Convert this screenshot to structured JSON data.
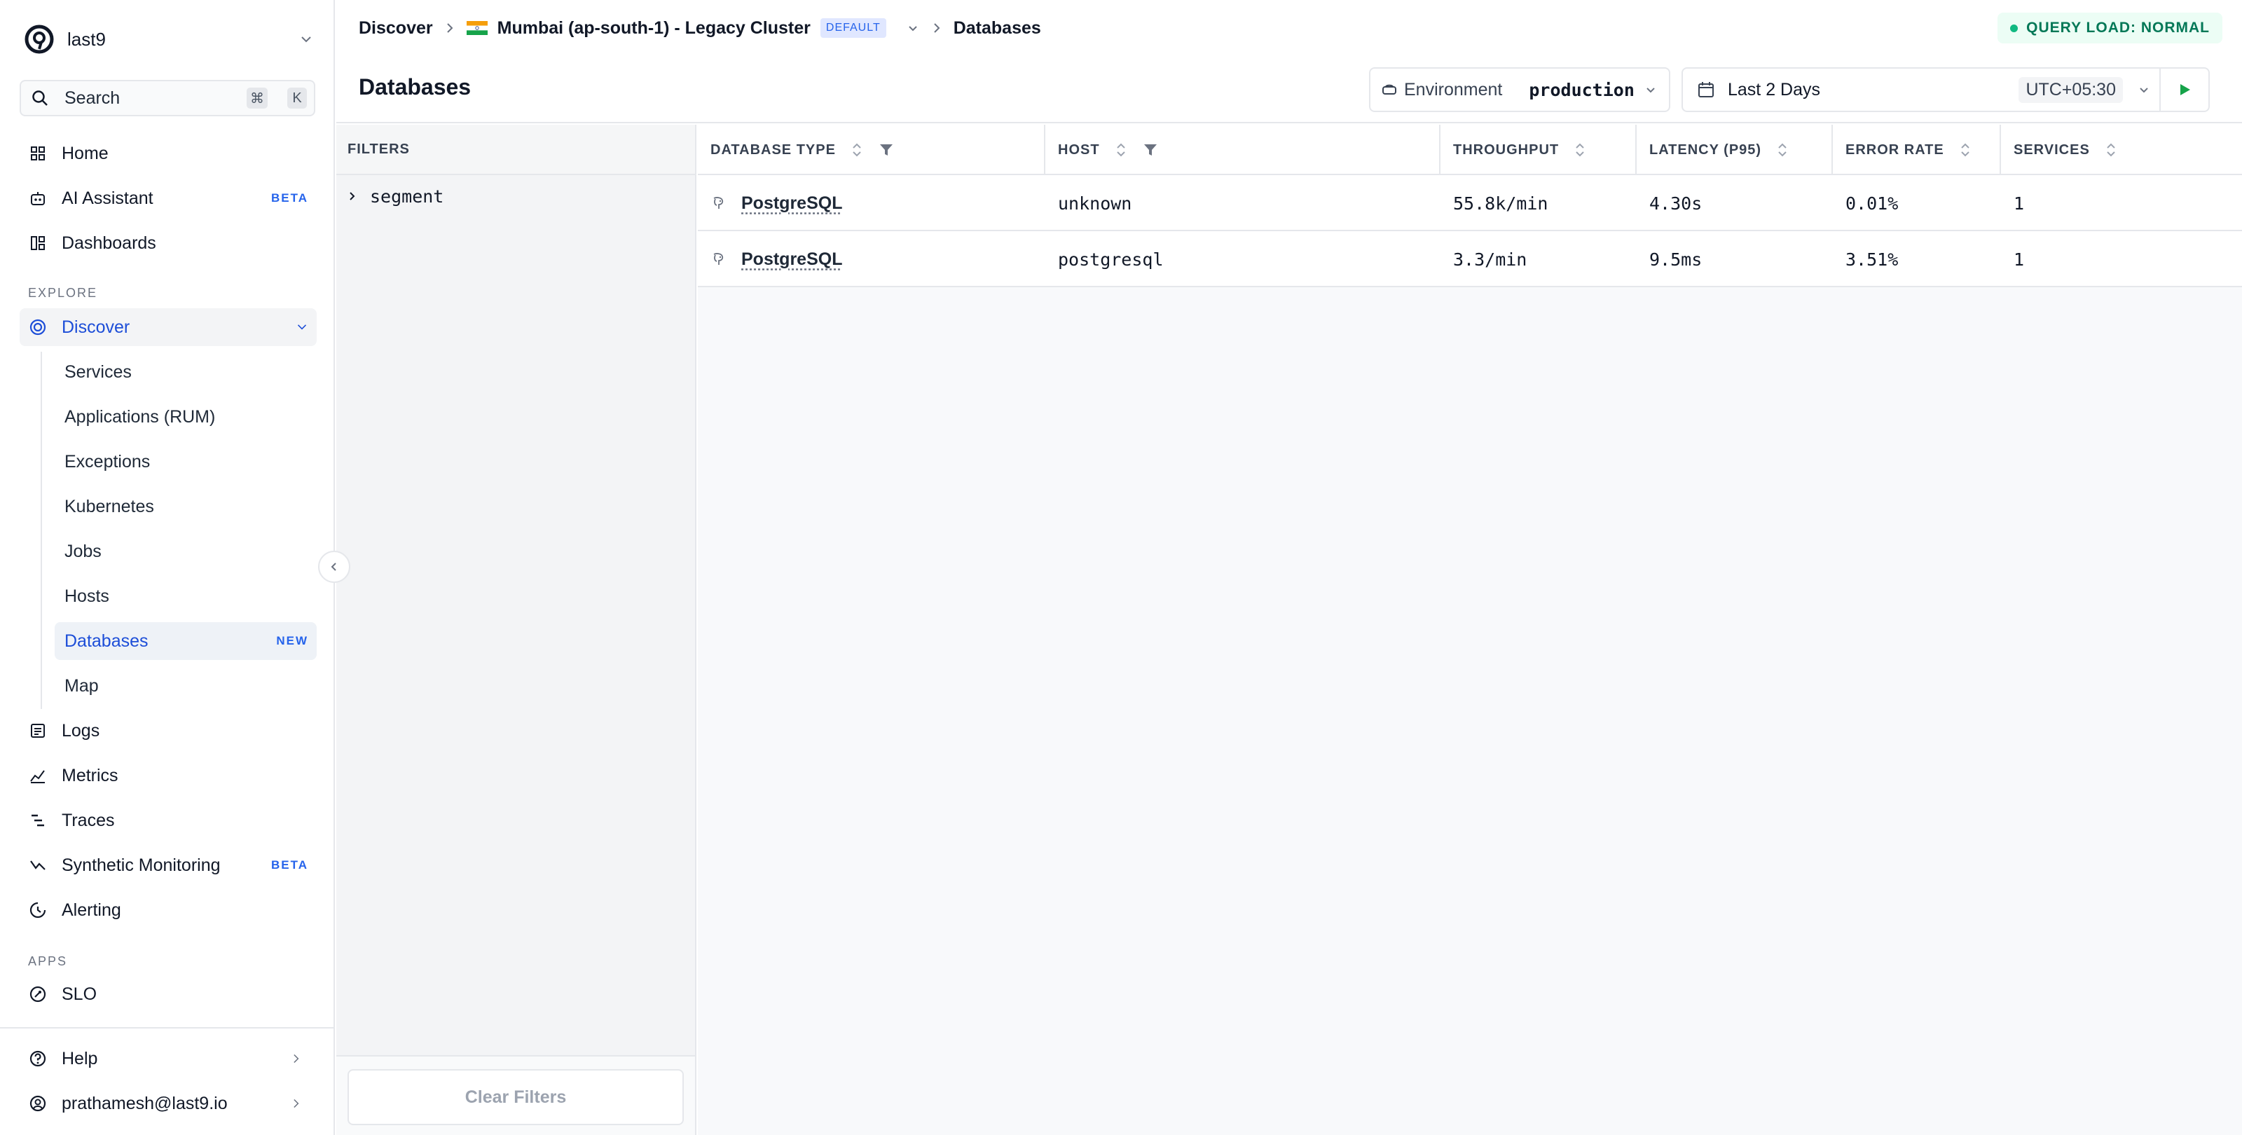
{
  "org": {
    "name": "last9"
  },
  "search": {
    "label": "Search",
    "shortcut_cmd": "⌘",
    "shortcut_key": "K"
  },
  "nav": {
    "home": "Home",
    "ai_assistant": "AI Assistant",
    "ai_badge": "BETA",
    "dashboards": "Dashboards",
    "explore_label": "EXPLORE",
    "discover": "Discover",
    "sub": {
      "services": "Services",
      "applications": "Applications (RUM)",
      "exceptions": "Exceptions",
      "kubernetes": "Kubernetes",
      "jobs": "Jobs",
      "hosts": "Hosts",
      "databases": "Databases",
      "databases_badge": "NEW",
      "map": "Map"
    },
    "logs": "Logs",
    "metrics": "Metrics",
    "traces": "Traces",
    "synthetic": "Synthetic Monitoring",
    "synthetic_badge": "BETA",
    "alerting": "Alerting",
    "apps_label": "APPS",
    "slo": "SLO",
    "help": "Help",
    "user": "prathamesh@last9.io"
  },
  "header": {
    "breadcrumb_root": "Discover",
    "cluster": "Mumbai (ap-south-1) - Legacy Cluster",
    "cluster_badge": "DEFAULT",
    "breadcrumb_current": "Databases",
    "query_load": "QUERY LOAD: NORMAL",
    "page_title": "Databases",
    "env_label": "Environment",
    "env_value": "production",
    "time_range": "Last 2 Days",
    "timezone": "UTC+05:30"
  },
  "filters": {
    "title": "FILTERS",
    "items": [
      "segment"
    ],
    "clear_label": "Clear Filters"
  },
  "table": {
    "columns": [
      "DATABASE TYPE",
      "HOST",
      "THROUGHPUT",
      "LATENCY (P95)",
      "ERROR RATE",
      "SERVICES"
    ],
    "rows": [
      {
        "type": "PostgreSQL",
        "host": "unknown",
        "throughput": "55.8k/min",
        "latency": "4.30s",
        "error_rate": "0.01%",
        "services": "1"
      },
      {
        "type": "PostgreSQL",
        "host": "postgresql",
        "throughput": "3.3/min",
        "latency": "9.5ms",
        "error_rate": "3.51%",
        "services": "1"
      }
    ]
  },
  "colors": {
    "accent": "#1d4ed8",
    "status_ok": "#10b981",
    "run_button": "#16a34a"
  }
}
